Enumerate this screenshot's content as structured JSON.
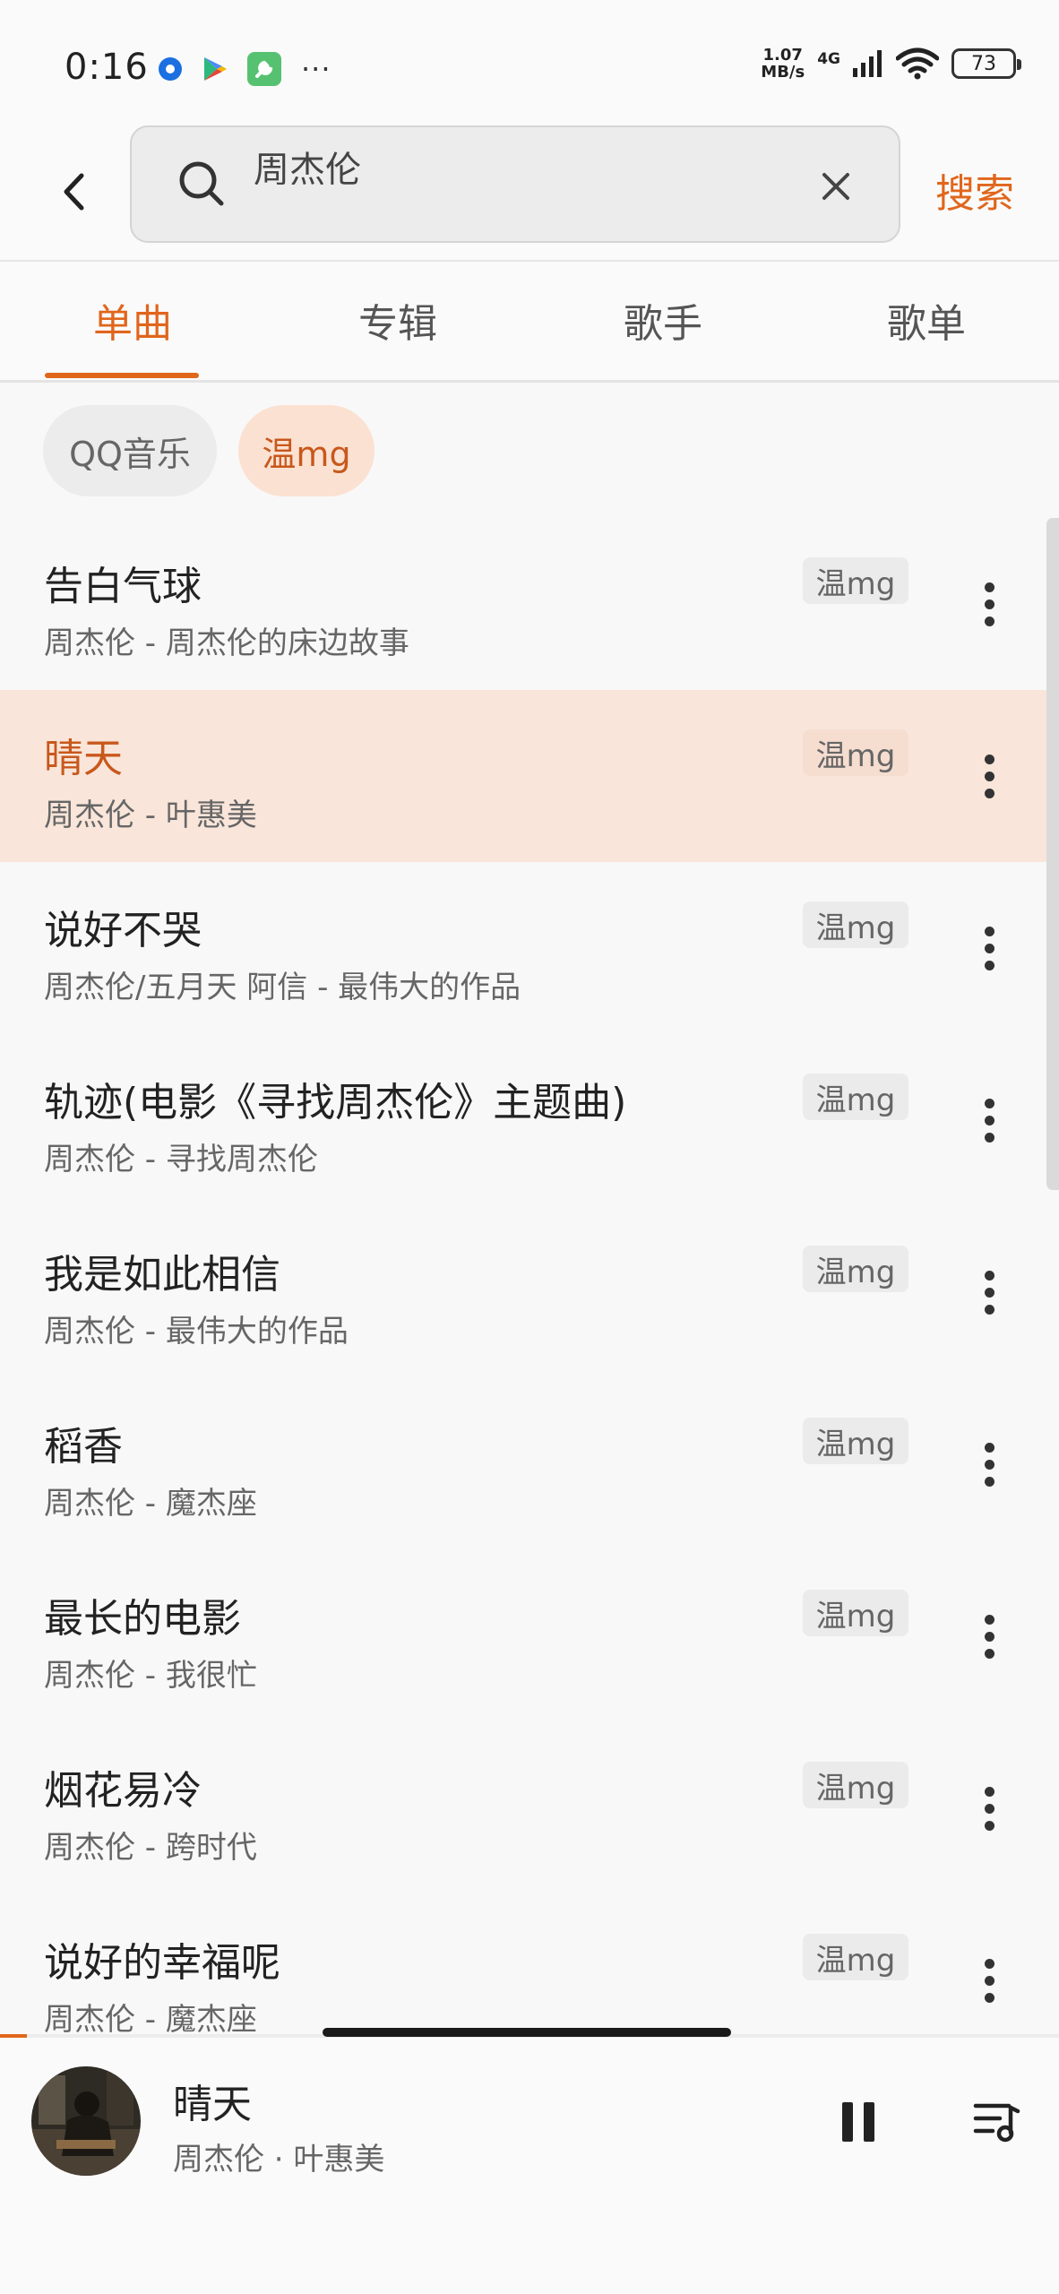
{
  "status_bar": {
    "time": "0:16",
    "app_icons": [
      "app-blue-icon",
      "play-store-icon",
      "tool-app-icon"
    ],
    "more": "···",
    "net_speed_value": "1.07",
    "net_speed_unit": "MB/s",
    "net_type": "4G",
    "battery": "73"
  },
  "search": {
    "query": "周杰伦",
    "button_label": "搜索"
  },
  "tabs": [
    {
      "label": "单曲",
      "active": true
    },
    {
      "label": "专辑",
      "active": false
    },
    {
      "label": "歌手",
      "active": false
    },
    {
      "label": "歌单",
      "active": false
    }
  ],
  "sources": {
    "qq": "QQ音乐",
    "wen": "温mg"
  },
  "songs": [
    {
      "title": "告白气球",
      "subtitle": "周杰伦 - 周杰伦的床边故事",
      "source": "温mg",
      "playing": false
    },
    {
      "title": "晴天",
      "subtitle": "周杰伦 - 叶惠美",
      "source": "温mg",
      "playing": true
    },
    {
      "title": "说好不哭",
      "subtitle": "周杰伦/五月天 阿信 - 最伟大的作品",
      "source": "温mg",
      "playing": false
    },
    {
      "title": "轨迹(电影《寻找周杰伦》主题曲)",
      "subtitle": "周杰伦 - 寻找周杰伦",
      "source": "温mg",
      "playing": false
    },
    {
      "title": "我是如此相信",
      "subtitle": "周杰伦 - 最伟大的作品",
      "source": "温mg",
      "playing": false
    },
    {
      "title": "稻香",
      "subtitle": "周杰伦 - 魔杰座",
      "source": "温mg",
      "playing": false
    },
    {
      "title": "最长的电影",
      "subtitle": "周杰伦 - 我很忙",
      "source": "温mg",
      "playing": false
    },
    {
      "title": "烟花易冷",
      "subtitle": "周杰伦 - 跨时代",
      "source": "温mg",
      "playing": false
    },
    {
      "title": "说好的幸福呢",
      "subtitle": "周杰伦 - 魔杰座",
      "source": "温mg",
      "playing": false
    }
  ],
  "player": {
    "title": "晴天",
    "artist": "周杰伦 · 叶惠美",
    "progress": 0.025
  },
  "colors": {
    "accent": "#e0661c",
    "playing_bg": "#f9e5d9",
    "chip_active_bg": "#fbe1d2"
  }
}
